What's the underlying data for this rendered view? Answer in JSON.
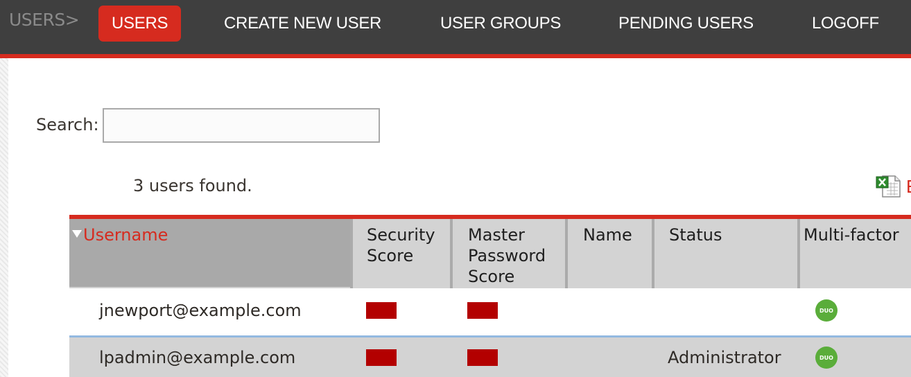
{
  "nav": {
    "breadcrumb": "USERS>",
    "items": [
      {
        "label": "USERS",
        "active": true
      },
      {
        "label": "CREATE NEW USER",
        "active": false
      },
      {
        "label": "USER GROUPS",
        "active": false
      },
      {
        "label": "PENDING USERS",
        "active": false
      },
      {
        "label": "LOGOFF",
        "active": false
      }
    ]
  },
  "search": {
    "label": "Search:",
    "value": "",
    "placeholder": ""
  },
  "results": {
    "count_text": "3 users found."
  },
  "export": {
    "icon": "excel-spreadsheet-icon",
    "label": "E"
  },
  "table": {
    "sorted_column": "Username",
    "sort_direction": "descending",
    "columns": [
      {
        "label": "Username"
      },
      {
        "label": "Security Score",
        "lines": [
          "Security",
          "Score"
        ]
      },
      {
        "label": "Master Password Score",
        "lines": [
          "Master",
          "Password",
          "Score"
        ]
      },
      {
        "label": "Name"
      },
      {
        "label": "Status"
      },
      {
        "label": "Multi-factor"
      }
    ],
    "rows": [
      {
        "username": "jnewport@example.com",
        "security_score": "low",
        "master_password_score": "low",
        "name": "",
        "status": "",
        "multifactor": "Duo"
      },
      {
        "username": "lpadmin@example.com",
        "security_score": "low",
        "master_password_score": "low",
        "name": "",
        "status": "Administrator",
        "multifactor": "Duo"
      }
    ]
  },
  "colors": {
    "accent": "#d62b1f",
    "topbar": "#3f3f3f",
    "score_bar": "#b30000",
    "duo_green": "#5aad3a",
    "row_alt": "#d3d3d3",
    "row_separator": "#93b9e0"
  }
}
